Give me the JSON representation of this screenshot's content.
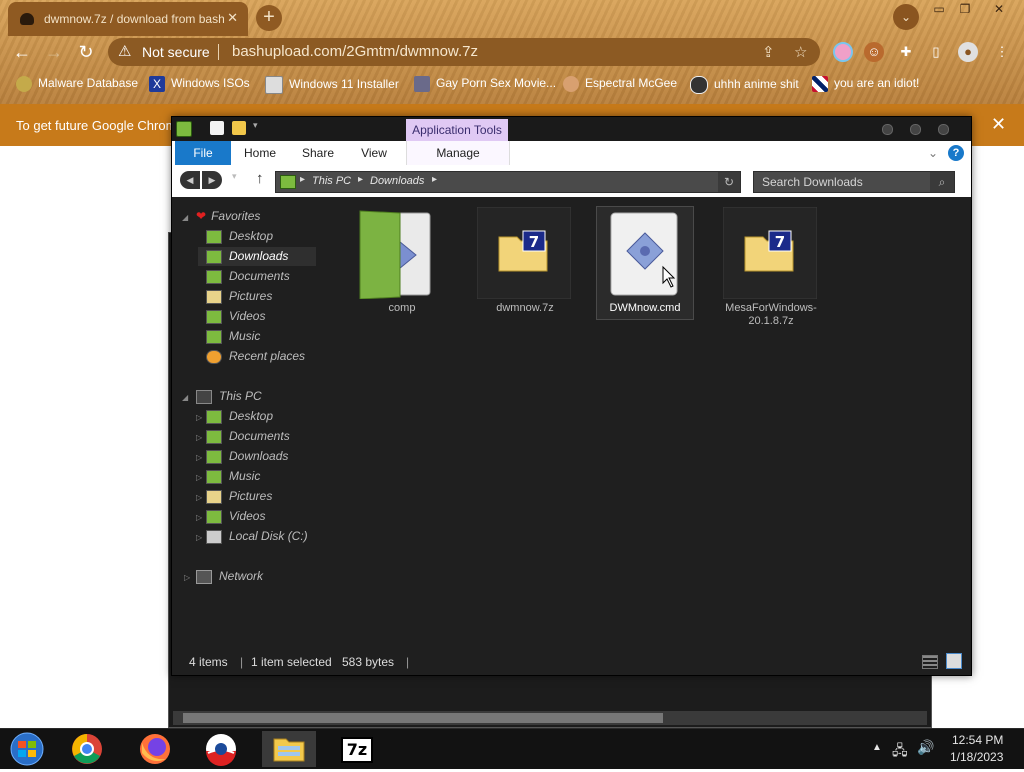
{
  "browser": {
    "tab_title": "dwmnow.7z / download from bash",
    "tab_close": "✕",
    "new_tab": "+",
    "security_text": "Not secure",
    "url": "bashupload.com/2Gmtm/dwmnow.7z",
    "bookmarks": [
      {
        "label": "Malware Database",
        "icon": "biohazard-icon"
      },
      {
        "label": "Windows ISOs",
        "icon": "x-logo-icon"
      },
      {
        "label": "Windows 11 Installer",
        "icon": "image-icon"
      },
      {
        "label": "Gay Porn Sex Movie...",
        "icon": "game-icon"
      },
      {
        "label": "Espectral McGee",
        "icon": "face-icon"
      },
      {
        "label": "uhhh anime shit",
        "icon": "anime-icon"
      },
      {
        "label": "you are an idiot!",
        "icon": "flag-icon"
      }
    ],
    "infobar_text": "To get future Google Chrom",
    "infobar_close": "✕"
  },
  "explorer": {
    "context_tab": "Application Tools",
    "ribbon_tabs": [
      "File",
      "Home",
      "Share",
      "View",
      "Manage"
    ],
    "breadcrumb": [
      "This PC",
      "Downloads"
    ],
    "search_placeholder": "Search Downloads",
    "nav": {
      "favorites_header": "Favorites",
      "favorites": [
        "Desktop",
        "Downloads",
        "Documents",
        "Pictures",
        "Videos",
        "Music",
        "Recent places"
      ],
      "thispc_header": "This PC",
      "thispc": [
        "Desktop",
        "Documents",
        "Downloads",
        "Music",
        "Pictures",
        "Videos",
        "Local Disk (C:)"
      ],
      "network": "Network"
    },
    "files": [
      {
        "name": "comp",
        "icon": "folder-icon"
      },
      {
        "name": "dwmnow.7z",
        "icon": "7z-archive-icon"
      },
      {
        "name": "DWMnow.cmd",
        "icon": "cmd-script-icon"
      },
      {
        "name": "MesaForWindows-20.1.8.7z",
        "icon": "7z-archive-icon"
      }
    ],
    "status": {
      "count": "4 items",
      "selection": "1 item selected",
      "size": "583 bytes"
    }
  },
  "taskbar": {
    "apps": [
      "start-orb-icon",
      "chrome-icon",
      "firefox-icon",
      "obama-logo-icon",
      "file-explorer-icon",
      "7zip-icon"
    ],
    "sevenzip_label": "7z",
    "time": "12:54 PM",
    "date": "1/18/2023"
  },
  "colors": {
    "accent": "#1979ca",
    "context_tab": "#e0c9f4",
    "chrome_theme": "#c89048",
    "infobar": "#c77a1a"
  }
}
